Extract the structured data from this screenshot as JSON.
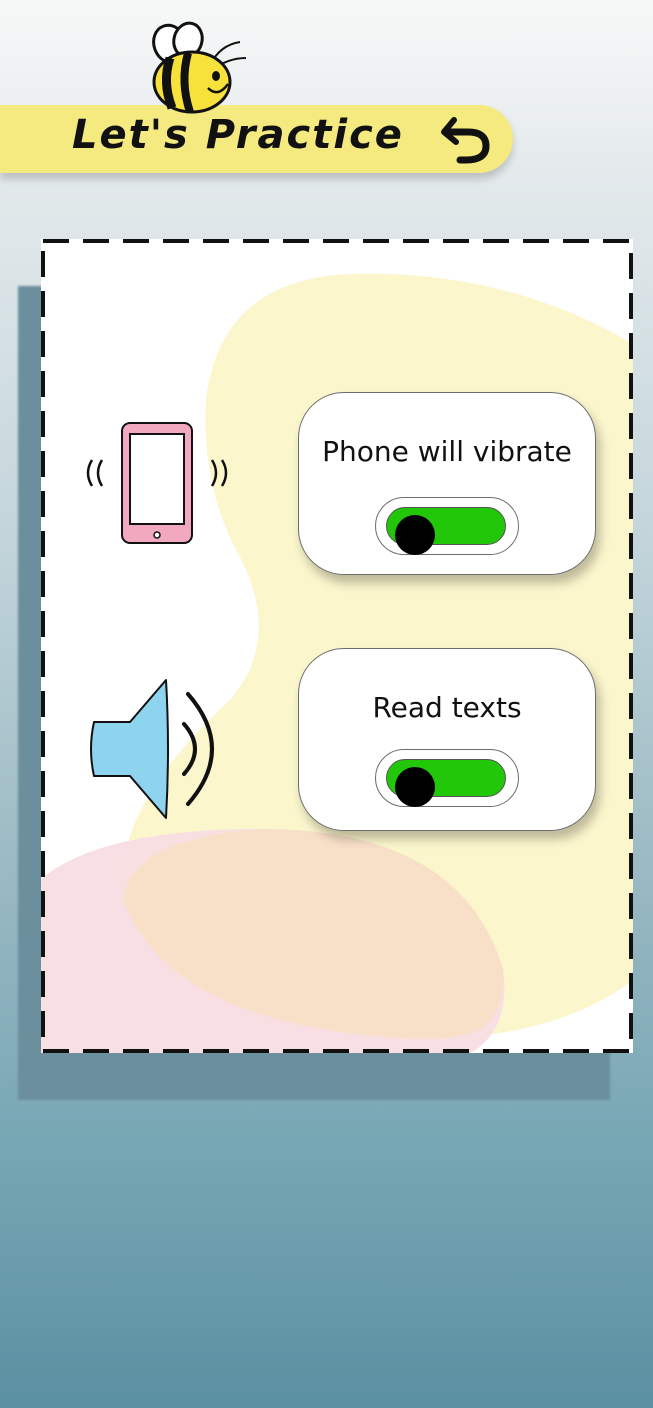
{
  "header": {
    "title": "Let's Practice",
    "back_icon": "undo-arrow-icon",
    "mascot_icon": "bee-icon",
    "bar_color": "#f4ea7f"
  },
  "practice_card": {
    "settings": [
      {
        "label": "Phone will vibrate",
        "icon": "vibrating-phone-icon",
        "toggle_on": true
      },
      {
        "label": "Read texts",
        "icon": "speaker-volume-icon",
        "toggle_on": true
      }
    ]
  },
  "colors": {
    "toggle_on": "#22c70a",
    "phone": "#f2a8bf",
    "speaker": "#8fd4ef",
    "blob_yellow": "#fbf6cc",
    "blob_pink": "#f8dde3"
  }
}
